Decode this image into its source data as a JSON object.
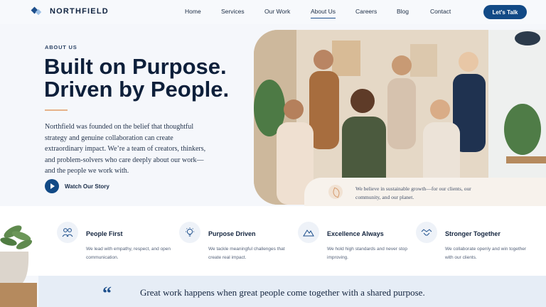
{
  "brand": {
    "name": "NORTHFIELD"
  },
  "nav": {
    "items": [
      {
        "label": "Home",
        "active": false
      },
      {
        "label": "Services",
        "active": false
      },
      {
        "label": "Our Work",
        "active": false
      },
      {
        "label": "About Us",
        "active": true
      },
      {
        "label": "Careers",
        "active": false
      },
      {
        "label": "Blog",
        "active": false
      },
      {
        "label": "Contact",
        "active": false
      }
    ],
    "cta": "Let's Talk"
  },
  "hero": {
    "eyebrow": "ABOUT US",
    "headline_line1": "Built on Purpose.",
    "headline_line2": "Driven by People.",
    "intro": "Northfield was founded on the belief that thoughtful strategy and genuine collaboration can create extraordinary impact. We’re a team of creators, thinkers, and problem-solvers who care deeply about our work—and the people we work with.",
    "watch_label": "Watch Our Story",
    "photo_icon": "team-photo",
    "belief": "We believe in sustainable growth—for our clients, our community, and our planet."
  },
  "values": [
    {
      "icon": "people-icon",
      "title": "People First",
      "desc": "We lead with empathy, respect, and open communication."
    },
    {
      "icon": "lightbulb-icon",
      "title": "Purpose Driven",
      "desc": "We tackle meaningful challenges that create real impact."
    },
    {
      "icon": "mountain-icon",
      "title": "Excellence Always",
      "desc": "We hold high standards and never stop improving."
    },
    {
      "icon": "handshake-icon",
      "title": "Stronger Together",
      "desc": "We collaborate openly and win together with our clients."
    }
  ],
  "quote": {
    "marks": "“",
    "text": "Great work happens when great people come together with a shared purpose."
  },
  "colors": {
    "primary": "#124a86",
    "accent": "#e6b28a",
    "text": "#0f2340"
  }
}
